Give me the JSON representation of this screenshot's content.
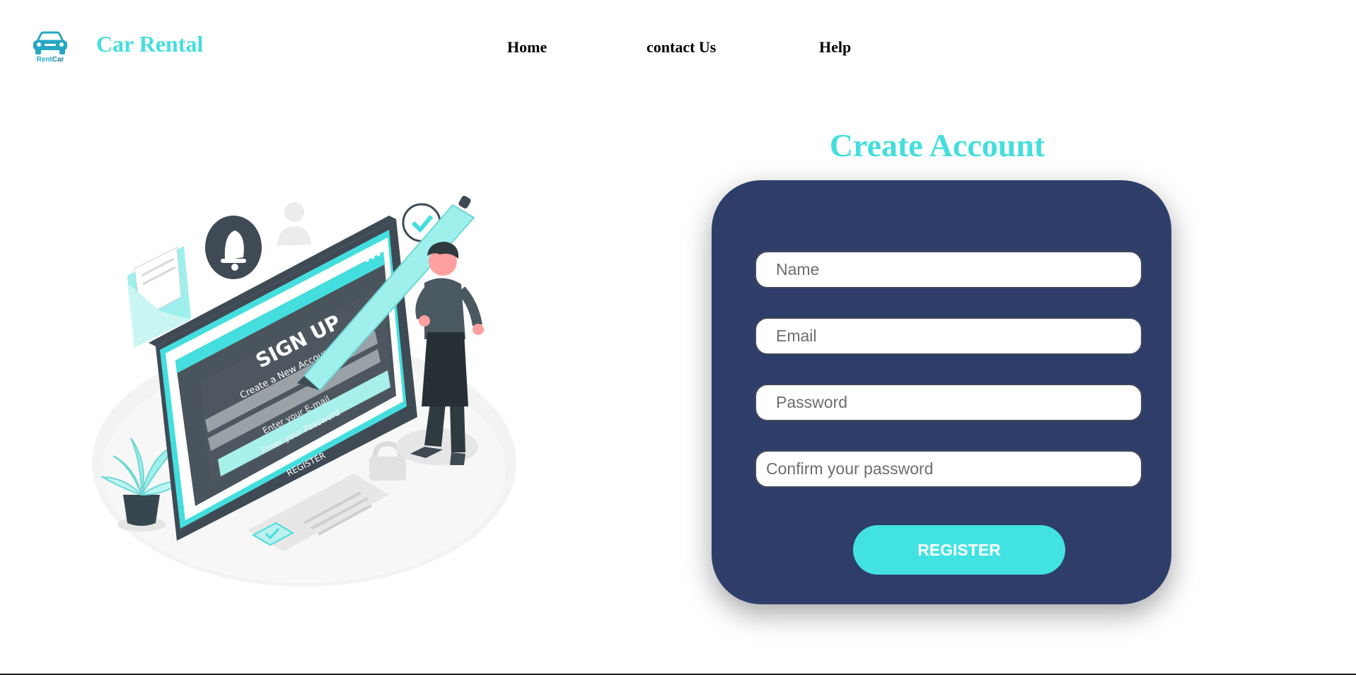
{
  "header": {
    "logo": {
      "icon": "car-icon",
      "text_rent": "Rent",
      "text_car": "Car"
    },
    "brand": "Car Rental",
    "nav": [
      {
        "label": "Home"
      },
      {
        "label": "contact Us"
      },
      {
        "label": "Help"
      }
    ]
  },
  "illustration": {
    "icon": "signup-illustration",
    "title": "SIGN UP",
    "subtitle": "Create a New Account is Free",
    "email_placeholder": "Enter your E-mail",
    "password_placeholder": "Enter your Password",
    "button": "REGISTER"
  },
  "form": {
    "title": "Create Account",
    "name_placeholder": "Name",
    "email_placeholder": "Email",
    "password_placeholder": "Password",
    "confirm_placeholder": "Confirm your password",
    "register_label": "REGISTER"
  },
  "colors": {
    "accent": "#45dede",
    "card": "#2e3e69",
    "button": "#43e2e2"
  }
}
